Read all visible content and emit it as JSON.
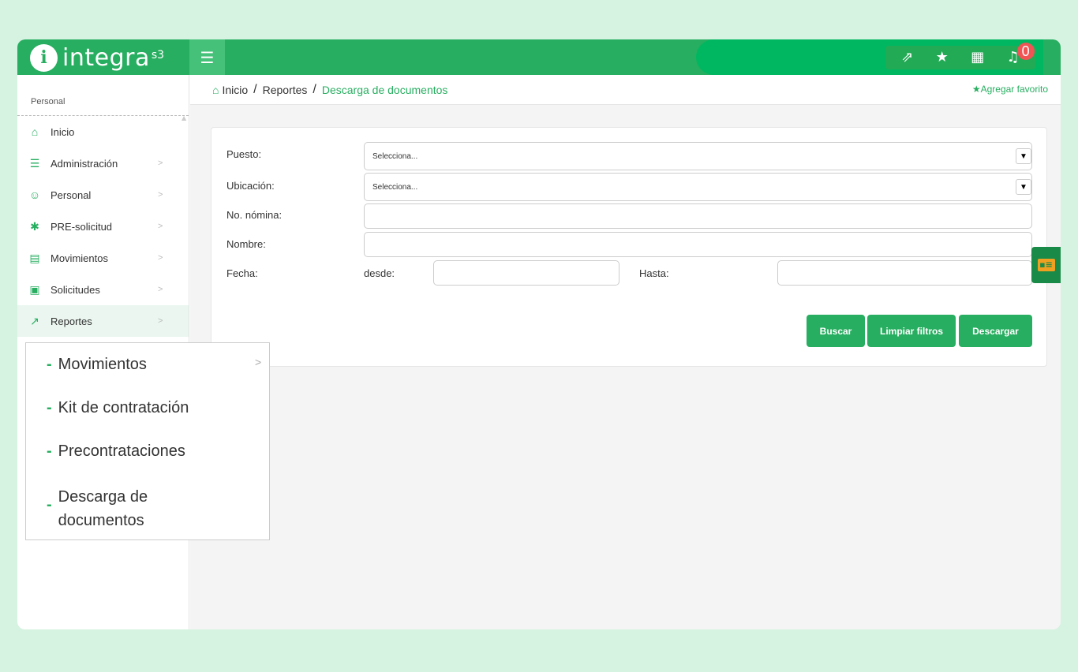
{
  "header": {
    "logo_mark": "i",
    "logo_text": "integra",
    "logo_sup": "s3",
    "menu_icon": "hamburger-icon",
    "notifications_count": "0",
    "icons": [
      "growth-icon",
      "star-icon",
      "apps-icon",
      "bell-icon"
    ]
  },
  "sidebar": {
    "section_title": "Personal",
    "items": [
      {
        "label": "Inicio",
        "icon": "home-icon"
      },
      {
        "label": "Administración",
        "icon": "list-icon"
      },
      {
        "label": "Personal",
        "icon": "person-board-icon"
      },
      {
        "label": "PRE-solicitud",
        "icon": "person-star-icon"
      },
      {
        "label": "Movimientos",
        "icon": "card-icon"
      },
      {
        "label": "Solicitudes",
        "icon": "contact-icon"
      },
      {
        "label": "Reportes",
        "icon": "chart-icon"
      }
    ]
  },
  "submenu": {
    "items": [
      {
        "label": "Movimientos"
      },
      {
        "label": "Kit de contratación"
      },
      {
        "label": "Precontrataciones"
      },
      {
        "label": "Descarga de documentos"
      }
    ],
    "item4_line1": "Descarga de",
    "item4_line2": "documentos"
  },
  "breadcrumb": {
    "home": "Inicio",
    "section": "Reportes",
    "current": "Descarga de documentos",
    "favorite": "Agregar favorito"
  },
  "form": {
    "puesto_label": "Puesto:",
    "puesto_value": "Selecciona...",
    "ubicacion_label": "Ubicación:",
    "ubicacion_value": "Selecciona...",
    "nomina_label": "No. nómina:",
    "nomina_value": "",
    "nombre_label": "Nombre:",
    "nombre_value": "",
    "fecha_label": "Fecha:",
    "desde_label": "desde:",
    "desde_value": "",
    "hasta_label": "Hasta:",
    "hasta_value": ""
  },
  "buttons": {
    "buscar": "Buscar",
    "limpiar": "Limpiar filtros",
    "descargar": "Descargar"
  },
  "colors": {
    "brand_green": "#27ae60",
    "page_bg": "#d6f2e0",
    "badge_red": "#f05454"
  }
}
